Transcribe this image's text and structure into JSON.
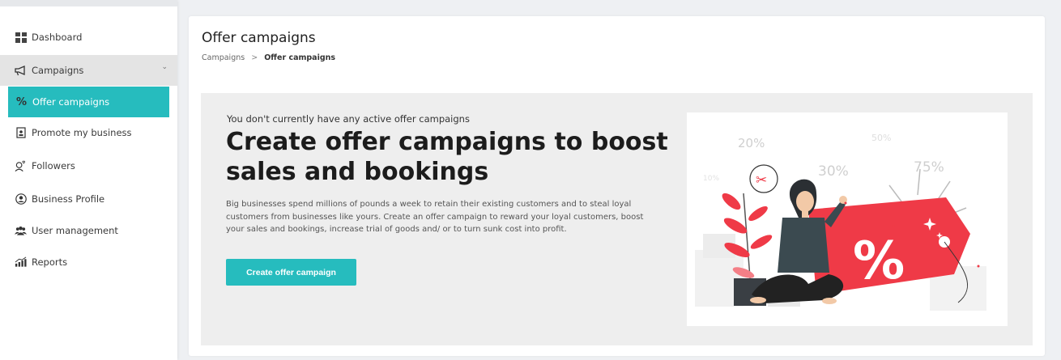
{
  "sidebar": {
    "items": [
      {
        "label": "Dashboard",
        "icon": "dashboard-grid-icon"
      },
      {
        "label": "Campaigns",
        "icon": "megaphone-icon"
      },
      {
        "label": "Offer campaigns",
        "icon": "percent-icon"
      },
      {
        "label": "Promote my business",
        "icon": "promote-icon"
      },
      {
        "label": "Followers",
        "icon": "followers-icon"
      },
      {
        "label": "Business Profile",
        "icon": "profile-icon"
      },
      {
        "label": "User management",
        "icon": "users-icon"
      },
      {
        "label": "Reports",
        "icon": "reports-chart-icon"
      }
    ]
  },
  "header": {
    "title": "Offer campaigns",
    "breadcrumb": {
      "parent": "Campaigns",
      "separator": ">",
      "current": "Offer campaigns"
    }
  },
  "hero": {
    "subtitle": "You don't currently have any active offer campaigns",
    "title": "Create offer campaigns to boost sales and bookings",
    "body": "Big businesses spend millions of pounds a week to retain their existing customers and to steal loyal customers from businesses like yours. Create an offer campaign to reward your loyal customers, boost your sales and bookings, increase trial of goods and/ or to turn sunk cost into profit.",
    "cta_label": "Create offer campaign",
    "illustration": {
      "percent_labels": [
        "20%",
        "30%",
        "50%",
        "75%",
        "10%"
      ],
      "tag_symbol": "%",
      "scissors": "✂"
    }
  },
  "colors": {
    "accent": "#26bcbe",
    "tag_red": "#ef3a47",
    "hero_bg": "#eeeeee"
  }
}
